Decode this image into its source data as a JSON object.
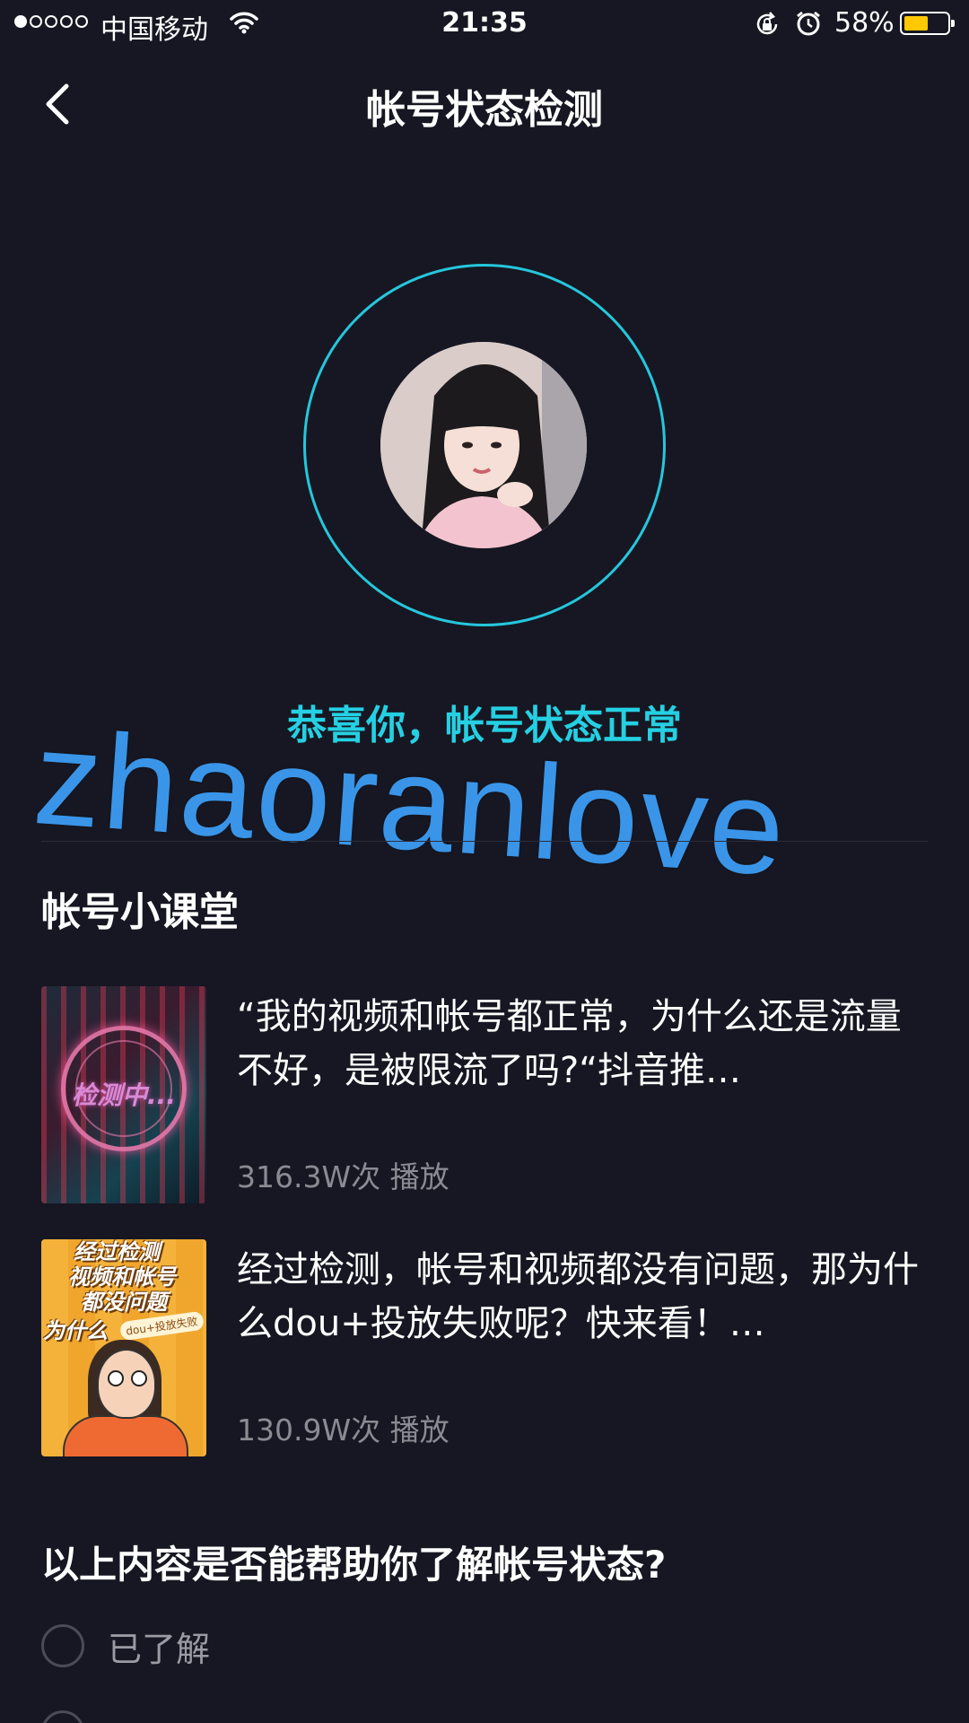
{
  "status_bar": {
    "carrier": "中国移动",
    "time": "21:35",
    "battery_percent": "58%",
    "battery_level": 0.58,
    "signal_bars": 1,
    "signal_total": 5
  },
  "nav": {
    "title": "帐号状态检测"
  },
  "status": {
    "message": "恭喜你，帐号状态正常",
    "accent_color": "#25d0e3"
  },
  "watermark": "zhaoranlove",
  "course": {
    "section_title": "帐号小课堂",
    "articles": [
      {
        "title": "“我的视频和帐号都正常，为什么还是流量不好，是被限流了吗?“抖音推…",
        "plays": "316.3W次 播放",
        "thumb_text": "检测中..."
      },
      {
        "title": "经过检测，帐号和视频都没有问题，那为什么dou+投放失败呢？快来看！…",
        "plays": "130.9W次 播放",
        "thumb_lines": [
          "经过检测",
          "视频和帐号",
          "都没问题",
          "为什么"
        ],
        "thumb_tag": "dou+投放失败"
      }
    ]
  },
  "survey": {
    "question": "以上内容是否能帮助你了解帐号状态?",
    "options": [
      "已了解"
    ]
  }
}
